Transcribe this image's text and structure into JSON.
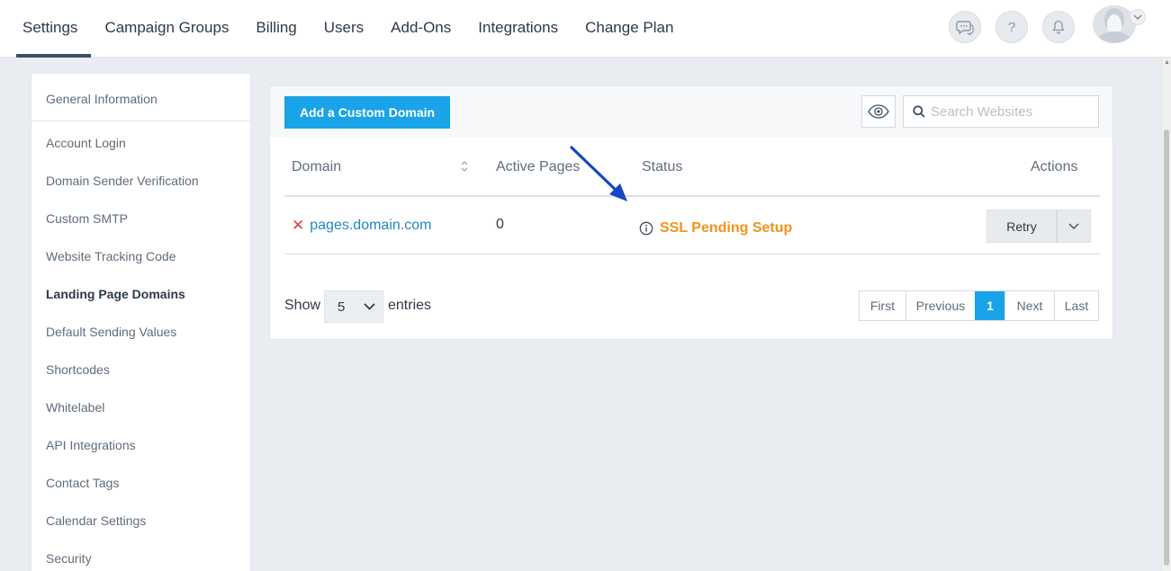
{
  "nav": {
    "items": [
      {
        "label": "Settings",
        "active": true
      },
      {
        "label": "Campaign Groups"
      },
      {
        "label": "Billing"
      },
      {
        "label": "Users"
      },
      {
        "label": "Add-Ons"
      },
      {
        "label": "Integrations"
      },
      {
        "label": "Change Plan"
      }
    ],
    "help_label": "?"
  },
  "sidebar": {
    "items": [
      {
        "label": "General Information"
      },
      {
        "label": "Account Login"
      },
      {
        "label": "Domain Sender Verification"
      },
      {
        "label": "Custom SMTP"
      },
      {
        "label": "Website Tracking Code"
      },
      {
        "label": "Landing Page Domains",
        "active": true
      },
      {
        "label": "Default Sending Values"
      },
      {
        "label": "Shortcodes"
      },
      {
        "label": "Whitelabel"
      },
      {
        "label": "API Integrations"
      },
      {
        "label": "Contact Tags"
      },
      {
        "label": "Calendar Settings"
      },
      {
        "label": "Security"
      }
    ]
  },
  "main": {
    "add_button_label": "Add a Custom Domain",
    "search_placeholder": "Search Websites",
    "columns": [
      "Domain",
      "Active Pages",
      "Status",
      "Actions"
    ],
    "rows": [
      {
        "domain": "pages.domain.com",
        "active_pages": "0",
        "status": "SSL Pending Setup",
        "action": "Retry"
      }
    ],
    "show_label": "Show",
    "entries_value": "5",
    "entries_label": "entries",
    "pagination": [
      "First",
      "Previous",
      "1",
      "Next",
      "Last"
    ],
    "current_page": "1"
  },
  "colors": {
    "accent": "#1aa3e8",
    "status_pending": "#f39220",
    "delete_red": "#e53d3d",
    "link": "#1e88c8",
    "annotation_arrow": "#1746c4"
  }
}
